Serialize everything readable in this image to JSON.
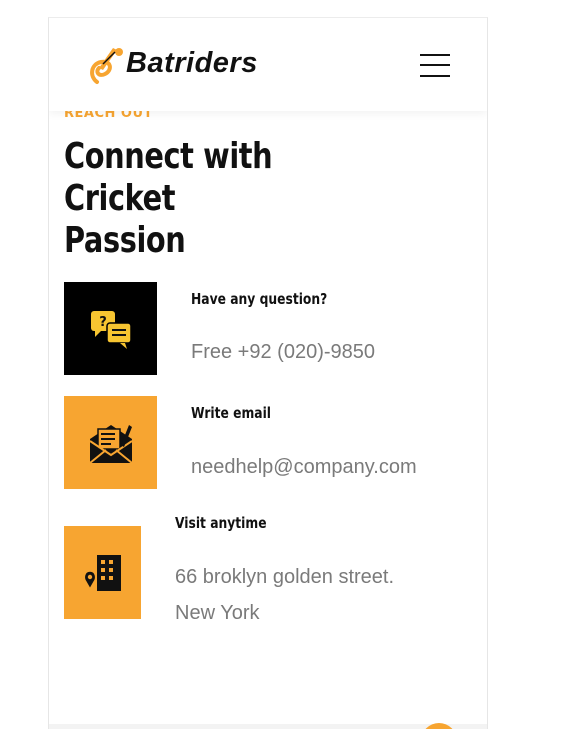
{
  "brand": {
    "name": "Batriders"
  },
  "contact": {
    "eyebrow": "REACH OUT",
    "title_line1": "Connect with Cricket",
    "title_line2": "Passion",
    "items": [
      {
        "label": "Have any question?",
        "value": "Free +92 (020)-9850"
      },
      {
        "label": "Write email",
        "value": "needhelp@company.com"
      },
      {
        "label": "Visit anytime",
        "value_line1": "66 broklyn golden street.",
        "value_line2": "New York"
      }
    ]
  },
  "colors": {
    "accent": "#f7a531",
    "text": "#111111",
    "muted": "#7a7a7a"
  },
  "icons": [
    "bat-ball-logo-icon",
    "menu-icon",
    "chat-question-icon",
    "envelope-letter-icon",
    "building-location-icon"
  ]
}
